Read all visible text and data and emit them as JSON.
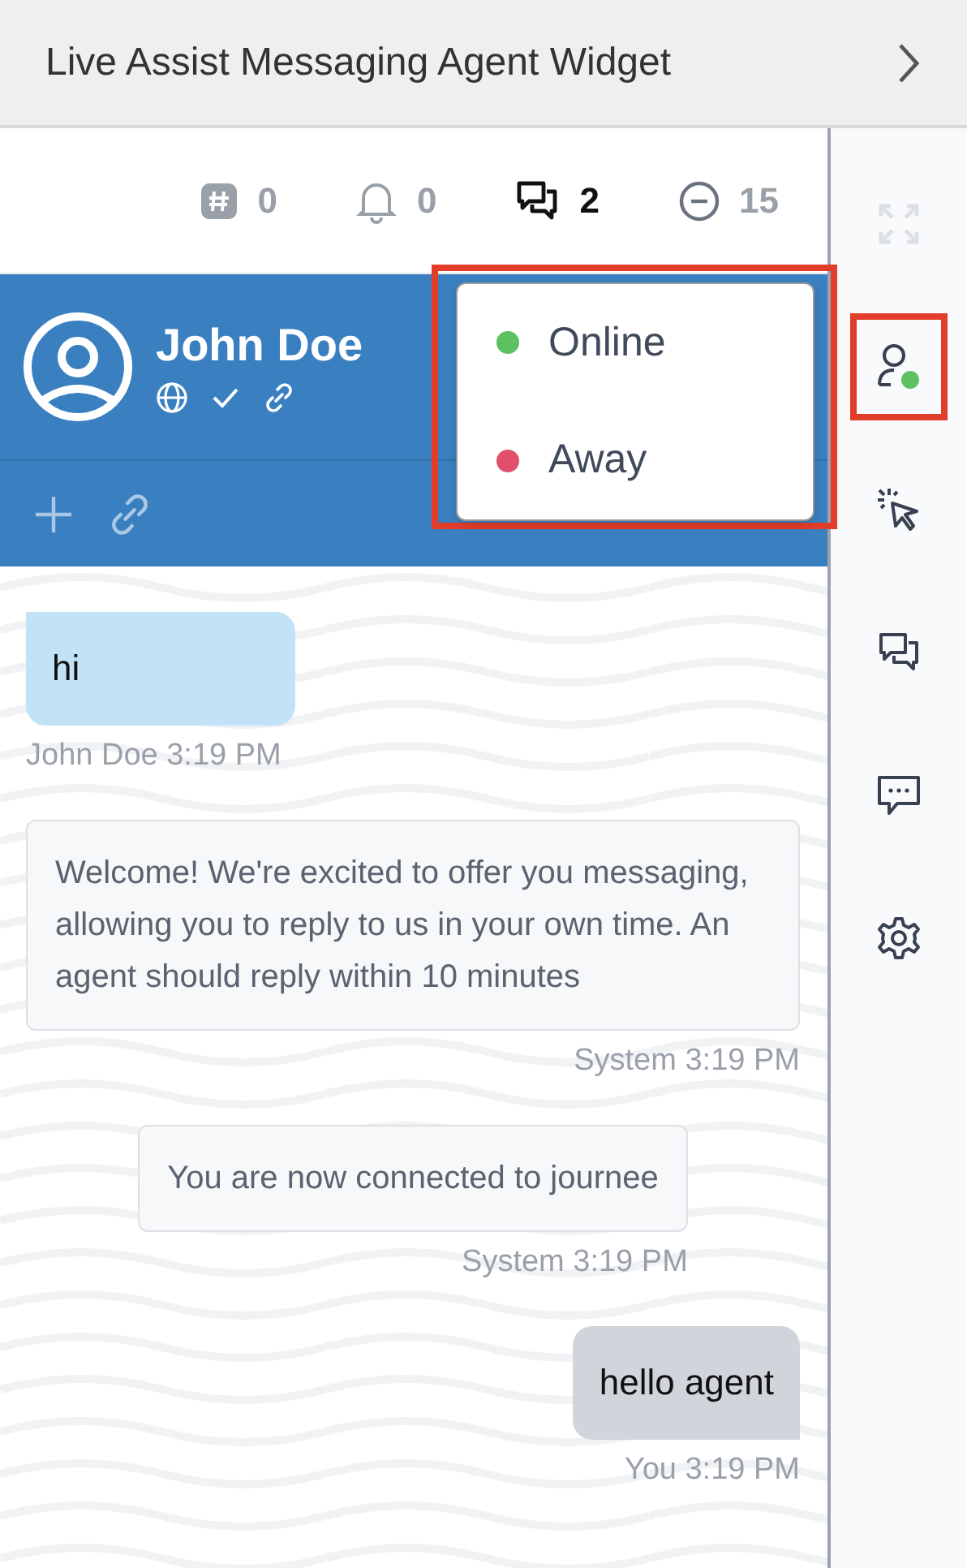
{
  "window": {
    "title": "Live Assist Messaging Agent Widget"
  },
  "stats": [
    {
      "kind": "hash",
      "count": "0",
      "highlighted": false
    },
    {
      "kind": "bell",
      "count": "0",
      "highlighted": false
    },
    {
      "kind": "chats",
      "count": "2",
      "highlighted": true
    },
    {
      "kind": "minus",
      "count": "15",
      "highlighted": false
    }
  ],
  "contact": {
    "name": "John Doe"
  },
  "status_menu": {
    "items": [
      {
        "label": "Online",
        "color": "#5cc161"
      },
      {
        "label": "Away",
        "color": "#e0506a"
      }
    ]
  },
  "rail": [
    {
      "kind": "expand",
      "disabled": true,
      "highlighted": false
    },
    {
      "kind": "user",
      "disabled": false,
      "highlighted": true
    },
    {
      "kind": "cursor",
      "disabled": false,
      "highlighted": false
    },
    {
      "kind": "chats",
      "disabled": false,
      "highlighted": false
    },
    {
      "kind": "comment",
      "disabled": false,
      "highlighted": false
    },
    {
      "kind": "settings",
      "disabled": false,
      "highlighted": false
    }
  ],
  "messages": [
    {
      "kind": "customer",
      "text": "hi",
      "meta": "John Doe 3:19 PM"
    },
    {
      "kind": "system",
      "text": "Welcome! We're excited to offer you messaging, allowing you to reply to us in your own time. An agent should reply within 10 minutes",
      "meta": "System 3:19 PM"
    },
    {
      "kind": "notice",
      "text": "You are now connected to journee",
      "meta": "System 3:19 PM"
    },
    {
      "kind": "agent",
      "text": "hello agent",
      "meta": "You 3:19 PM"
    }
  ]
}
